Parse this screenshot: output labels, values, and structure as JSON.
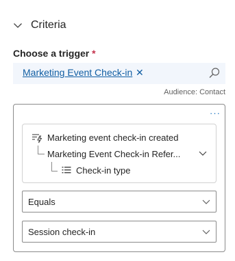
{
  "section": {
    "title": "Criteria",
    "icon": "chevron-down-icon"
  },
  "trigger": {
    "label": "Choose a trigger",
    "required_mark": "*",
    "selected_tag": "Marketing Event Check-in",
    "remove_glyph": "✕",
    "search_icon": "search-icon"
  },
  "audience": "Audience: Contact",
  "condition": {
    "more_glyph": "···",
    "path": {
      "event": "Marketing event check-in created",
      "attribute": "Marketing Event Check-in Refer...",
      "field": "Check-in type"
    },
    "operator": "Equals",
    "value": "Session check-in"
  },
  "colors": {
    "accent": "#115ea3",
    "tag_bg": "#f2f6fc",
    "required": "#c4314b"
  }
}
